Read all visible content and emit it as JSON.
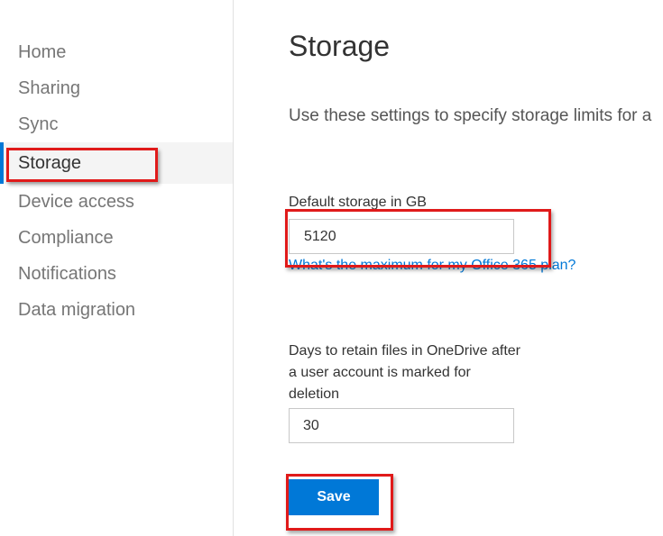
{
  "sidebar": {
    "items": [
      {
        "label": "Home",
        "active": false
      },
      {
        "label": "Sharing",
        "active": false
      },
      {
        "label": "Sync",
        "active": false
      },
      {
        "label": "Storage",
        "active": true
      },
      {
        "label": "Device access",
        "active": false
      },
      {
        "label": "Compliance",
        "active": false
      },
      {
        "label": "Notifications",
        "active": false
      },
      {
        "label": "Data migration",
        "active": false
      }
    ]
  },
  "main": {
    "title": "Storage",
    "description": "Use these settings to specify storage limits for a",
    "default_storage": {
      "label": "Default storage in GB",
      "value": "5120",
      "help_link": "What's the maximum for my Office 365 plan?"
    },
    "retention": {
      "label": "Days to retain files in OneDrive after a user account is marked for deletion",
      "value": "30"
    },
    "save_label": "Save"
  },
  "colors": {
    "accent": "#0078d7",
    "highlight": "#e01a1a"
  }
}
